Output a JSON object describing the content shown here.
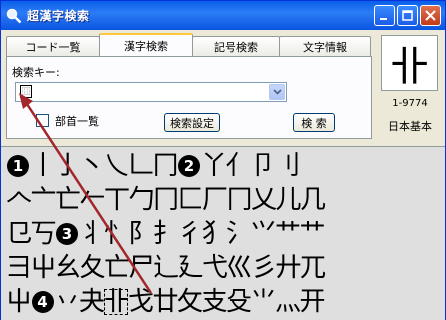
{
  "window": {
    "title": "超漢字検索",
    "accent": "#0a5fe9"
  },
  "tabs": [
    {
      "label": "コード一覧",
      "active": false
    },
    {
      "label": "漢字検索",
      "active": true
    },
    {
      "label": "記号検索",
      "active": false
    },
    {
      "label": "文字情報",
      "active": false
    }
  ],
  "search": {
    "label": "検索キー:",
    "value": "⿲"
  },
  "options": {
    "radical_list_label": "部首一覧",
    "settings_button": "検索設定",
    "search_button": "検 索"
  },
  "preview": {
    "char": "卝",
    "code": "1-9774",
    "kind": "日本基本"
  },
  "grid": {
    "rows": [
      [
        "❶",
        "丨",
        "亅",
        "丶",
        "乀",
        "𠃊",
        "冂",
        "❷",
        "丫",
        "亻",
        "卩",
        "刂"
      ],
      [
        "𠆢",
        "亠",
        "亡",
        "𠂉",
        "丅",
        "勹",
        "冂",
        "匚",
        "厂",
        "冂",
        "乂",
        "儿",
        "几"
      ],
      [
        "㔾",
        "丂",
        "❸",
        "丬",
        "忄",
        "阝",
        "扌",
        "彳",
        "犭",
        "氵",
        "⺍",
        "艹",
        "艹"
      ],
      [
        "彐",
        "屮",
        "幺",
        "夂",
        "亡",
        "尸",
        "辶",
        "廴",
        "弋",
        "巛",
        "彡",
        "廾",
        "兀"
      ],
      [
        "屮",
        "❹",
        "丷",
        "夬",
        "卝",
        "戈",
        "廿",
        "攵",
        "支",
        "殳",
        "⺌",
        "灬",
        "开"
      ]
    ]
  }
}
